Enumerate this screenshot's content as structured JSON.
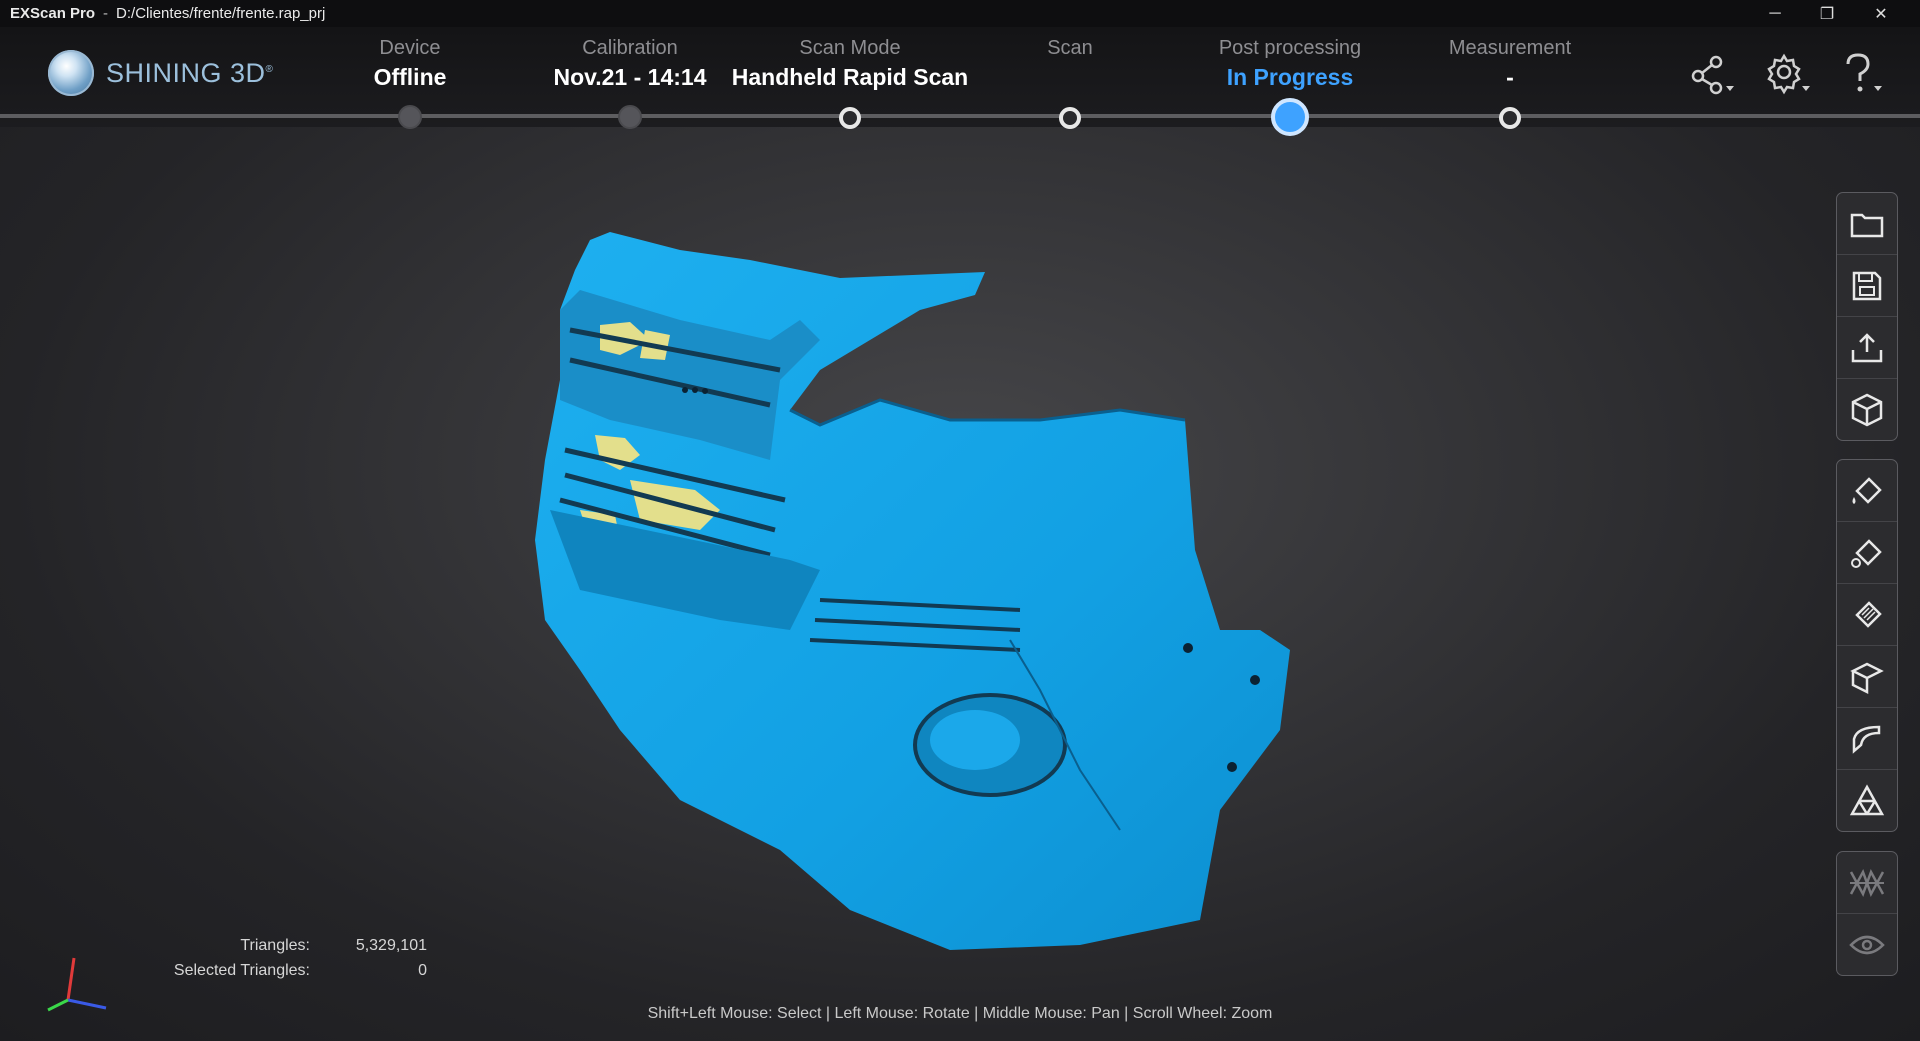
{
  "titlebar": {
    "app_name": "EXScan Pro",
    "separator": "-",
    "project_path": "D:/Clientes/frente/frente.rap_prj",
    "minimize": "─",
    "restore": "❐",
    "close": "✕"
  },
  "brand": {
    "logo_text": "SHINING 3D",
    "trademark": "®"
  },
  "steps": [
    {
      "label": "Device",
      "value": "Offline",
      "state": "done"
    },
    {
      "label": "Calibration",
      "value": "Nov.21 - 14:14",
      "state": "done"
    },
    {
      "label": "Scan Mode",
      "value": "Handheld Rapid Scan",
      "state": "open"
    },
    {
      "label": "Scan",
      "value": "",
      "state": "open"
    },
    {
      "label": "Post processing",
      "value": "In Progress",
      "state": "current"
    },
    {
      "label": "Measurement",
      "value": "-",
      "state": "open"
    }
  ],
  "header_icons": [
    "share-icon",
    "settings-icon",
    "help-icon"
  ],
  "toolbar_groups": [
    [
      "folder-open-icon",
      "save-icon",
      "export-icon",
      "cube-view-icon"
    ],
    [
      "fill-bucket-icon",
      "fill-bucket-alt-icon",
      "texture-fill-icon",
      "box-edit-icon",
      "surface-icon",
      "triangle-mesh-icon"
    ],
    [
      "section-icon",
      "visibility-eye-icon"
    ]
  ],
  "stats": {
    "triangles_label": "Triangles:",
    "triangles_value": "5,329,101",
    "selected_label": "Selected Triangles:",
    "selected_value": "0"
  },
  "hint": "Shift+Left Mouse: Select | Left Mouse: Rotate | Middle Mouse: Pan | Scroll Wheel: Zoom",
  "colors": {
    "mesh": "#13a0e3",
    "active": "#3ea2ff",
    "background": "#2c2c30",
    "highlight": "#e6e28a"
  }
}
